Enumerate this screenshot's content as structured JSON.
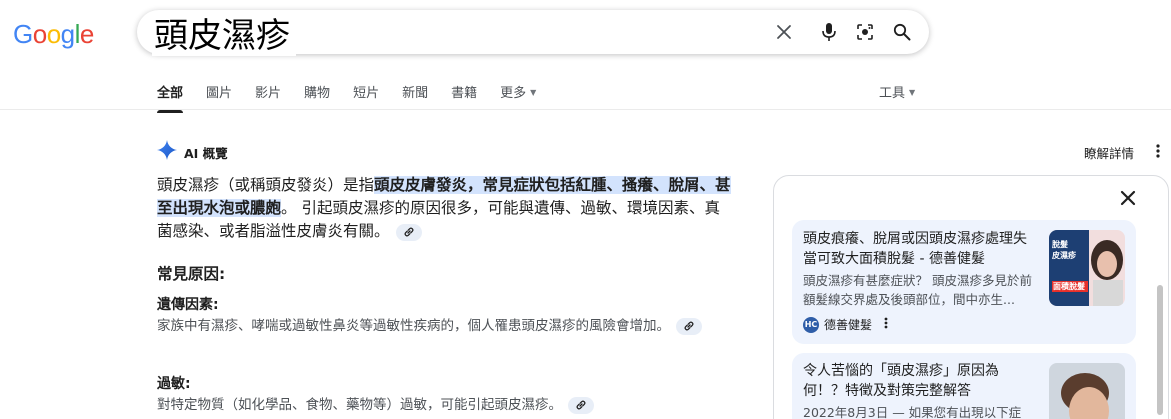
{
  "logo": {
    "text": "Google",
    "letters": [
      "G",
      "o",
      "o",
      "g",
      "l",
      "e"
    ],
    "colors": [
      "#4285f4",
      "#ea4335",
      "#fbbc05",
      "#4285f4",
      "#34a853",
      "#ea4335"
    ]
  },
  "search": {
    "query": "頭皮濕疹"
  },
  "icons": {
    "clear": "close-icon",
    "voice": "microphone-icon",
    "lens": "camera-lens-icon",
    "search": "search-icon"
  },
  "tabs": [
    {
      "label": "全部",
      "active": true
    },
    {
      "label": "圖片"
    },
    {
      "label": "影片"
    },
    {
      "label": "購物"
    },
    {
      "label": "短片"
    },
    {
      "label": "新聞"
    },
    {
      "label": "書籍"
    },
    {
      "label": "更多"
    }
  ],
  "tools_label": "工具",
  "ai_overview": {
    "title": "AI 概覽",
    "learn_more": "瞭解詳情",
    "summary_prefix": "頭皮濕疹（或稱頭皮發炎）是指",
    "summary_highlight": "頭皮皮膚發炎，常見症狀包括紅腫、搔癢、脫屑、甚至出現水泡或膿皰",
    "summary_suffix": "。 引起頭皮濕疹的原因很多，可能與遺傳、過敏、環境因素、真菌感染、或者脂溢性皮膚炎有關。",
    "section_title": "常見原因:",
    "items": [
      {
        "title": "遺傳因素:",
        "text": "家族中有濕疹、哮喘或過敏性鼻炎等過敏性疾病的，個人罹患頭皮濕疹的風險會增加。"
      },
      {
        "title": "過敏:",
        "text": "對特定物質（如化學品、食物、藥物等）過敏，可能引起頭皮濕疹。"
      }
    ]
  },
  "panel": {
    "cards": [
      {
        "title": "頭皮痕癢、脫屑或因頭皮濕疹處理失當可致大面積脫髮 - 德善健髮",
        "desc": "頭皮濕疹有甚麼症狀？ 頭皮濕疹多見於前額髮線交界處及後頭部位，間中亦生...",
        "source": "德善健髮",
        "favicon": "HC",
        "thumb_text": [
          "脫髮",
          "皮濕疹",
          "面積脫髮"
        ]
      },
      {
        "title": "令人苦惱的「頭皮濕疹」原因為何！？特徵及對策完整解答",
        "desc": "2022年8月3日 — 如果您有出現以下症"
      }
    ]
  }
}
